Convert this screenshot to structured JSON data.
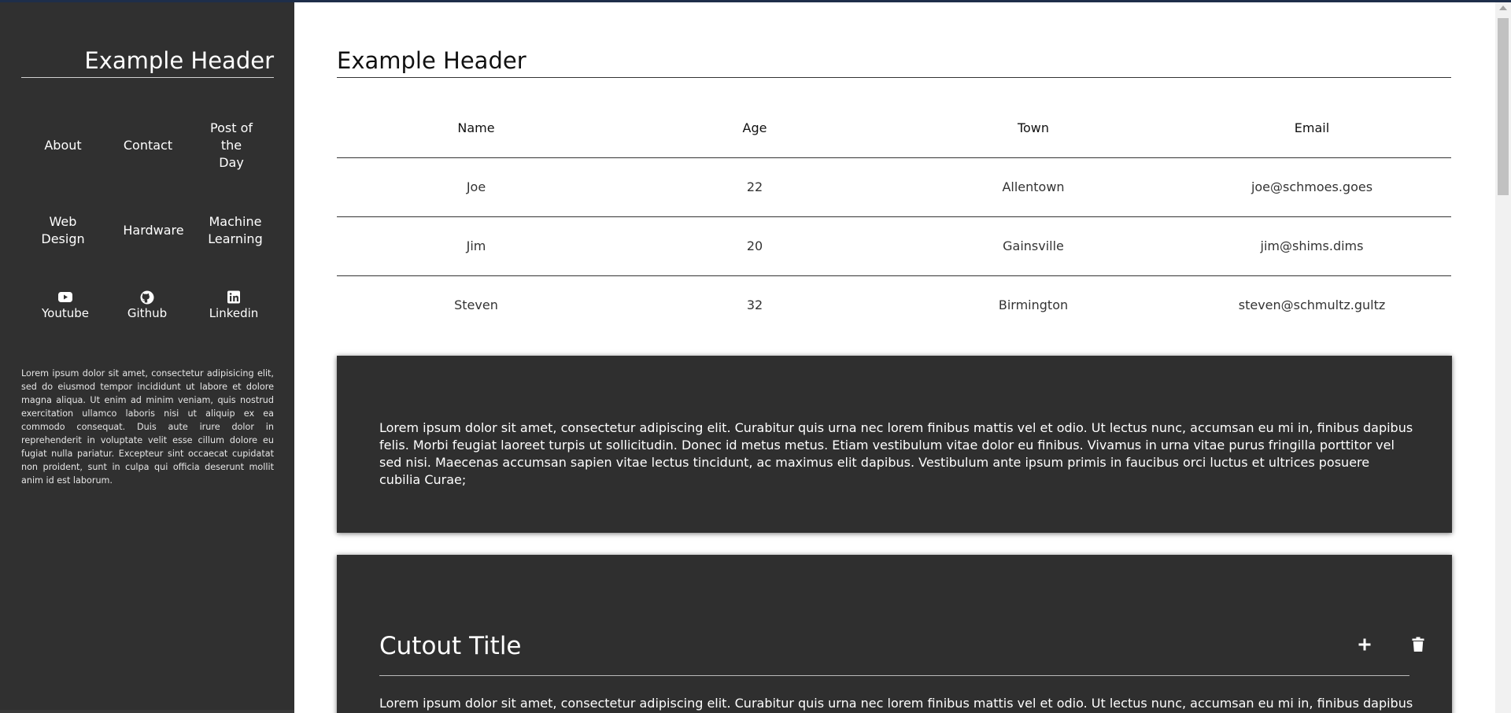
{
  "sidebar": {
    "header": "Example Header",
    "nav": {
      "about": "About",
      "contact": "Contact",
      "post_of_the_day": [
        "Post of",
        "the",
        "Day"
      ],
      "web_design": [
        "Web",
        "Design"
      ],
      "hardware": "Hardware",
      "machine_learning": [
        "Machine",
        "Learning"
      ]
    },
    "social": {
      "youtube": {
        "label": "Youtube",
        "icon": "youtube-icon"
      },
      "github": {
        "label": "Github",
        "icon": "github-icon"
      },
      "linkedin": {
        "label": "Linkedin",
        "icon": "linkedin-icon"
      }
    },
    "lorem": "Lorem ipsum dolor sit amet, consectetur adipisicing elit, sed do eiusmod tempor incididunt ut labore et dolore magna aliqua. Ut enim ad minim veniam, quis nostrud exercitation ullamco laboris nisi ut aliquip ex ea commodo consequat. Duis aute irure dolor in reprehenderit in voluptate velit esse cillum dolore eu fugiat nulla pariatur. Excepteur sint occaecat cupidatat non proident, sunt in culpa qui officia deserunt mollit anim id est laborum."
  },
  "main": {
    "header": "Example Header",
    "table": {
      "columns": [
        "Name",
        "Age",
        "Town",
        "Email"
      ],
      "rows": [
        [
          "Joe",
          "22",
          "Allentown",
          "joe@schmoes.goes"
        ],
        [
          "Jim",
          "20",
          "Gainsville",
          "jim@shims.dims"
        ],
        [
          "Steven",
          "32",
          "Birmington",
          "steven@schmultz.gultz"
        ]
      ]
    },
    "card1": {
      "text": "Lorem ipsum dolor sit amet, consectetur adipiscing elit. Curabitur quis urna nec lorem finibus mattis vel et odio. Ut lectus nunc, accumsan eu mi in, finibus dapibus felis. Morbi feugiat laoreet turpis ut sollicitudin. Donec id metus metus. Etiam vestibulum vitae dolor eu finibus. Vivamus in urna vitae purus fringilla porttitor vel sed nisi. Maecenas accumsan sapien vitae lectus tincidunt, ac maximus elit dapibus. Vestibulum ante ipsum primis in faucibus orci luctus et ultrices posuere cubilia Curae;"
    },
    "card2": {
      "title": "Cutout Title",
      "add_icon": "plus-icon",
      "delete_icon": "trash-icon",
      "text": "Lorem ipsum dolor sit amet, consectetur adipiscing elit. Curabitur quis urna nec lorem finibus mattis vel et odio. Ut lectus nunc, accumsan eu mi in, finibus dapibus felis. Morbi"
    }
  },
  "colors": {
    "sidebar_bg": "#303030",
    "card_bg": "#2f2f2f",
    "page_bg": "#ffffff",
    "accent_strip": "#1e2e4a"
  }
}
